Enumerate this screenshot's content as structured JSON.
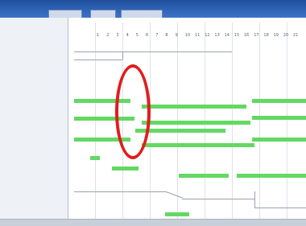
{
  "window": {
    "title": ""
  },
  "left_panel": {
    "rows": [
      "",
      "",
      "",
      "",
      "",
      "",
      "",
      "",
      "",
      "",
      "",
      "",
      "",
      "",
      "",
      "",
      "",
      "",
      "",
      "",
      "",
      "",
      "",
      "",
      "",
      ""
    ]
  },
  "grid": {
    "column_headers": [
      "",
      "",
      "",
      "",
      "",
      "",
      "",
      ""
    ],
    "ticks": [
      "1",
      "2",
      "3",
      "4",
      "5",
      "6",
      "7",
      "8",
      "9",
      "10",
      "11",
      "12",
      "13",
      "14",
      "15",
      "16",
      "17",
      "18",
      "19",
      "20",
      "21"
    ]
  },
  "colors": {
    "bar": "#63d863",
    "highlight": "#e11d1d",
    "titlebar": "#1f4f9c"
  },
  "annotation": {
    "shape": "red-oval-highlight"
  }
}
